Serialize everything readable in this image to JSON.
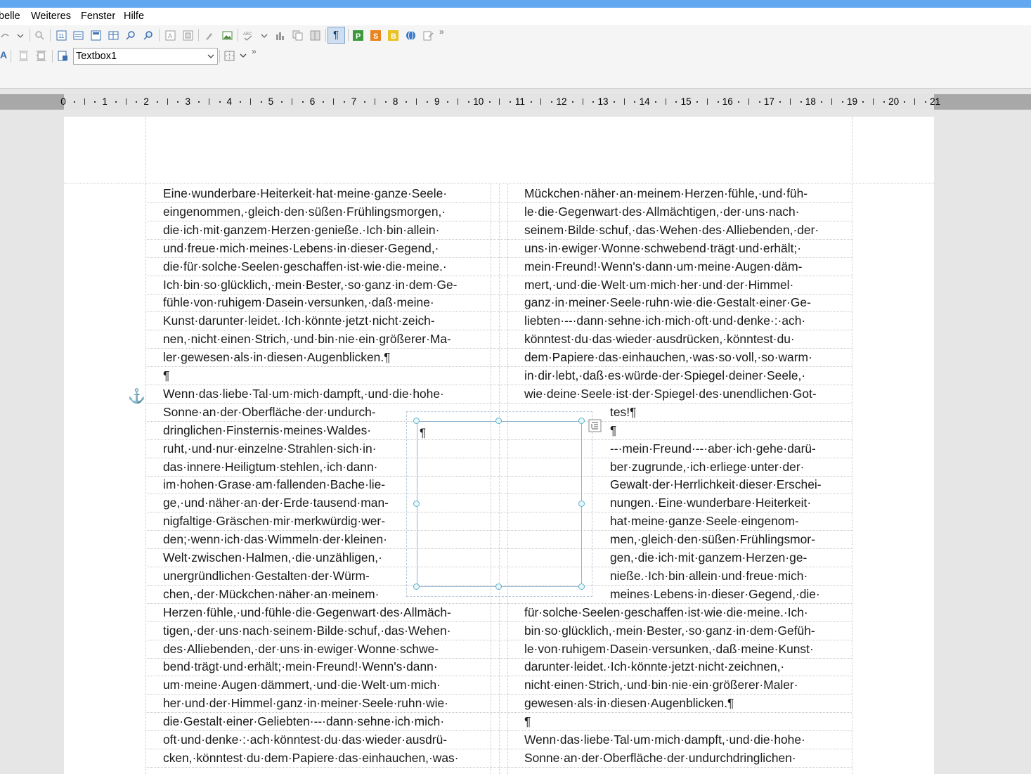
{
  "menu": [
    "belle",
    "Weiteres",
    "Fenster",
    "Hilfe"
  ],
  "toolbar2": {
    "style_name": "Textbox1"
  },
  "ruler": {
    "numbers": [
      "0",
      "1",
      "2",
      "3",
      "4",
      "5",
      "6",
      "7",
      "8",
      "9",
      "10",
      "11",
      "12",
      "13",
      "14",
      "15",
      "16",
      "17",
      "18",
      "19",
      "20",
      "21"
    ]
  },
  "textbox": {
    "pilcrow": "¶"
  },
  "anchor_icon": "⚓",
  "col_left": [
    "Eine·wunderbare·Heiterkeit·hat·meine·ganze·Seele·",
    "eingenommen,·gleich·den·süßen·Frühlingsmorgen,·",
    "die·ich·mit·ganzem·Herzen·genieße.·Ich·bin·allein·",
    "und·freue·mich·meines·Lebens·in·dieser·Gegend,·",
    "die·für·solche·Seelen·geschaffen·ist·wie·die·meine.·",
    "Ich·bin·so·glücklich,·mein·Bester,·so·ganz·in·dem·Ge-",
    "fühle·von·ruhigem·Dasein·versunken,·daß·meine·",
    "Kunst·darunter·leidet.·Ich·könnte·jetzt·nicht·zeich-",
    "nen,·nicht·einen·Strich,·und·bin·nie·ein·größerer·Ma-",
    "ler·gewesen·als·in·diesen·Augenblicken.¶",
    "¶",
    "Wenn·das·liebe·Tal·um·mich·dampft,·und·die·hohe·",
    "Sonne·an·der·Oberfläche·der·undurch-",
    "dringlichen·Finsternis·meines·Waldes·",
    "ruht,·und·nur·einzelne·Strahlen·sich·in·",
    "das·innere·Heiligtum·stehlen,·ich·dann·",
    "im·hohen·Grase·am·fallenden·Bache·lie-",
    "ge,·und·näher·an·der·Erde·tausend·man-",
    "nigfaltige·Gräschen·mir·merkwürdig·wer-",
    "den;·wenn·ich·das·Wimmeln·der·kleinen·",
    "Welt·zwischen·Halmen,·die·unzähligen,·",
    "unergründlichen·Gestalten·der·Würm-",
    "chen,·der·Mückchen·näher·an·meinem·",
    "Herzen·fühle,·und·fühle·die·Gegenwart·des·Allmäch-",
    "tigen,·der·uns·nach·seinem·Bilde·schuf,·das·Wehen·",
    "des·Alliebenden,·der·uns·in·ewiger·Wonne·schwe-",
    "bend·trägt·und·erhält;·mein·Freund!·Wenn's·dann·",
    "um·meine·Augen·dämmert,·und·die·Welt·um·mich·",
    "her·und·der·Himmel·ganz·in·meiner·Seele·ruhn·wie·",
    "die·Gestalt·einer·Geliebten·--·dann·sehne·ich·mich·",
    "oft·und·denke·:·ach·könntest·du·das·wieder·ausdrü-",
    "cken,·könntest·du·dem·Papiere·das·einhauchen,·was·"
  ],
  "col_right": [
    "Mückchen·näher·an·meinem·Herzen·fühle,·und·füh-",
    "le·die·Gegenwart·des·Allmächtigen,·der·uns·nach·",
    "seinem·Bilde·schuf,·das·Wehen·des·Alliebenden,·der·",
    "uns·in·ewiger·Wonne·schwebend·trägt·und·erhält;·",
    "mein·Freund!·Wenn's·dann·um·meine·Augen·däm-",
    "mert,·und·die·Welt·um·mich·her·und·der·Himmel·",
    "ganz·in·meiner·Seele·ruhn·wie·die·Gestalt·einer·Ge-",
    "liebten·--·dann·sehne·ich·mich·oft·und·denke·:·ach·",
    "könntest·du·das·wieder·ausdrücken,·könntest·du·",
    "dem·Papiere·das·einhauchen,·was·so·voll,·so·warm·",
    "in·dir·lebt,·daß·es·würde·der·Spiegel·deiner·Seele,·",
    "wie·deine·Seele·ist·der·Spiegel·des·unendlichen·Got-",
    "tes!¶",
    "¶",
    "--·mein·Freund·--·aber·ich·gehe·darü-",
    "ber·zugrunde,·ich·erliege·unter·der·",
    "Gewalt·der·Herrlichkeit·dieser·Erschei-",
    "nungen.·Eine·wunderbare·Heiterkeit·",
    "hat·meine·ganze·Seele·eingenom-",
    "men,·gleich·den·süßen·Frühlingsmor-",
    "gen,·die·ich·mit·ganzem·Herzen·ge-",
    "nieße.·Ich·bin·allein·und·freue·mich·",
    "meines·Lebens·in·dieser·Gegend,·die·",
    "für·solche·Seelen·geschaffen·ist·wie·die·meine.·Ich·",
    "bin·so·glücklich,·mein·Bester,·so·ganz·in·dem·Gefüh-",
    "le·von·ruhigem·Dasein·versunken,·daß·meine·Kunst·",
    "darunter·leidet.·Ich·könnte·jetzt·nicht·zeichnen,·",
    "nicht·einen·Strich,·und·bin·nie·ein·größerer·Maler·",
    "gewesen·als·in·diesen·Augenblicken.¶",
    "¶",
    "Wenn·das·liebe·Tal·um·mich·dampft,·und·die·hohe·",
    "Sonne·an·der·Oberfläche·der·undurchdringlichen·"
  ]
}
